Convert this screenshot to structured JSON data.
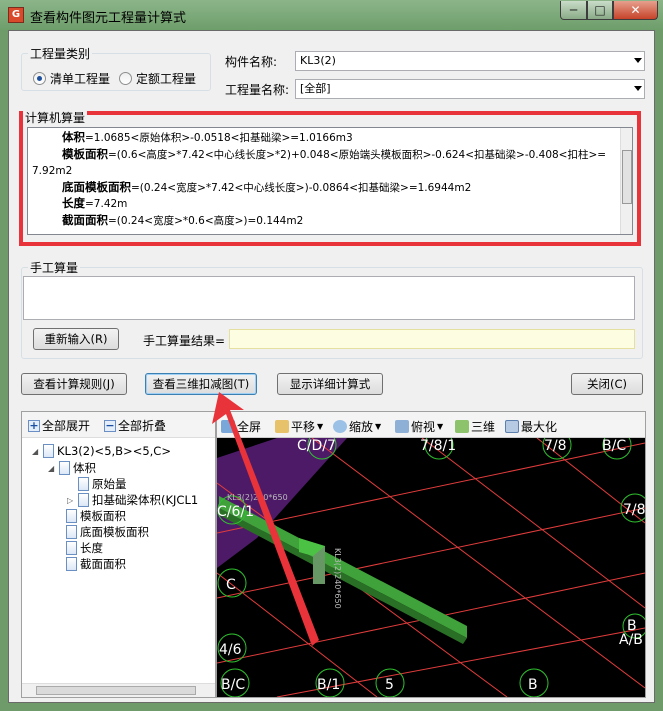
{
  "window": {
    "title": "查看构件图元工程量计算式",
    "min": "─",
    "max": "□",
    "close": "✕"
  },
  "quantity_type": {
    "legend": "工程量类别",
    "options": [
      {
        "label": "清单工程量",
        "selected": true
      },
      {
        "label": "定额工程量",
        "selected": false
      }
    ]
  },
  "component": {
    "label": "构件名称:",
    "value": "KL3(2)"
  },
  "quantity_name": {
    "label": "工程量名称:",
    "value": "[全部]"
  },
  "computer_calc": {
    "legend": "计算机算量",
    "lines": [
      {
        "name": "体积",
        "formula": "=1.0685<原始体积>-0.0518<扣基础梁>=1.0166m3"
      },
      {
        "name": "模板面积",
        "formula": "=(0.6<高度>*7.42<中心线长度>*2)+0.048<原始端头模板面积>-0.624<扣基础梁>-0.408<扣柱>="
      },
      {
        "name": "",
        "formula": "7.92m2"
      },
      {
        "name": "底面模板面积",
        "formula": "=(0.24<宽度>*7.42<中心线长度>)-0.0864<扣基础梁>=1.6944m2"
      },
      {
        "name": "长度",
        "formula": "=7.42m"
      },
      {
        "name": "截面面积",
        "formula": "=(0.24<宽度>*0.6<高度>)=0.144m2"
      }
    ]
  },
  "manual_calc": {
    "legend": "手工算量",
    "reenter_button": "重新输入(R)",
    "result_label": "手工算量结果=",
    "result_value": ""
  },
  "buttons": {
    "view_rules": "查看计算规则(J)",
    "view_3d": "查看三维扣减图(T)",
    "show_detail": "显示详细计算式",
    "close": "关闭(C)"
  },
  "tree": {
    "expand_all": "全部展开",
    "collapse_all": "全部折叠",
    "nodes": [
      {
        "label": "KL3(2)<5,B><5,C>",
        "twist": "◢"
      },
      {
        "label": "体积",
        "twist": "◢"
      },
      {
        "label": "原始量",
        "twist": ""
      },
      {
        "label": "扣基础梁体积(KJCL1",
        "twist": "▷"
      },
      {
        "label": "模板面积",
        "twist": ""
      },
      {
        "label": "底面模板面积",
        "twist": ""
      },
      {
        "label": "长度",
        "twist": ""
      },
      {
        "label": "截面面积",
        "twist": ""
      }
    ]
  },
  "view_toolbar": {
    "fullscreen": "全屏",
    "pan": "平移",
    "zoom": "缩放",
    "top_view": "俯视",
    "three_d": "三维",
    "maximize": "最大化"
  },
  "scene_labels": {
    "axes": [
      "C/D/7",
      "7/8/1",
      "7/8",
      "B/C",
      "C/6/1",
      "7/8",
      "C",
      "4/6",
      "B/C",
      "B/1",
      "5",
      "B",
      "B",
      "A/B"
    ],
    "beam_tag_1": "KL3(2)240*650",
    "beam_tag_2": "KL3(2)240*650"
  }
}
